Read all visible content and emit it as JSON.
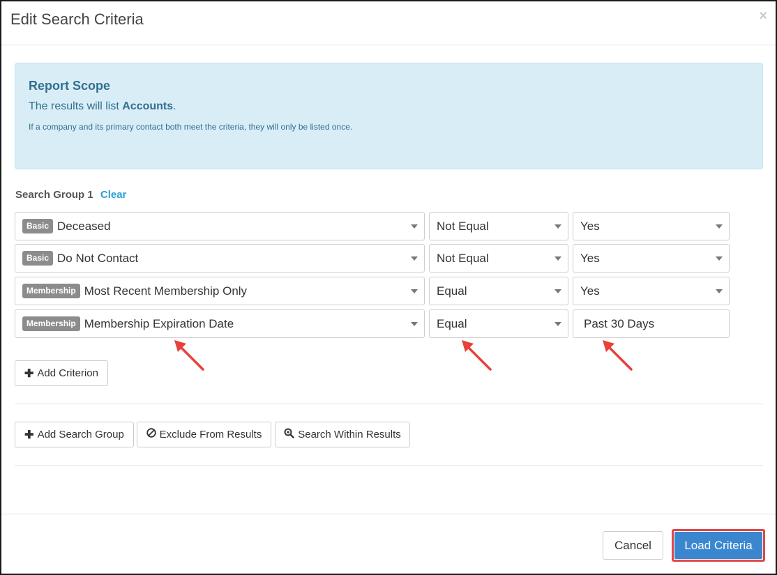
{
  "modal": {
    "title": "Edit Search Criteria",
    "close_symbol": "×"
  },
  "scope": {
    "title": "Report Scope",
    "line_prefix": "The results will list ",
    "line_bold": "Accounts",
    "line_suffix": ".",
    "note": "If a company and its primary contact both meet the criteria, they will only be listed once."
  },
  "group": {
    "title": "Search Group 1",
    "clear_label": "Clear"
  },
  "criteria": [
    {
      "badge": "Basic",
      "field": "Deceased",
      "operator": "Not Equal",
      "value": "Yes",
      "value_type": "select"
    },
    {
      "badge": "Basic",
      "field": "Do Not Contact",
      "operator": "Not Equal",
      "value": "Yes",
      "value_type": "select"
    },
    {
      "badge": "Membership",
      "field": "Most Recent Membership Only",
      "operator": "Equal",
      "value": "Yes",
      "value_type": "select"
    },
    {
      "badge": "Membership",
      "field": "Membership Expiration Date",
      "operator": "Equal",
      "value": "Past 30 Days",
      "value_type": "text"
    }
  ],
  "buttons": {
    "add_criterion": "Add Criterion",
    "add_search_group": "Add Search Group",
    "exclude_from_results": "Exclude From Results",
    "search_within_results": "Search Within Results",
    "cancel": "Cancel",
    "load_criteria": "Load Criteria"
  },
  "colors": {
    "scope_bg": "#d9edf7",
    "scope_text": "#31708f",
    "badge_bg": "#8c8c8c",
    "primary": "#3a87cf",
    "highlight": "#e04848",
    "link": "#2a9fd6"
  },
  "icons": {
    "close": "close-icon",
    "plus": "plus-icon",
    "ban": "ban-icon",
    "zoom": "zoom-in-icon",
    "caret": "chevron-down-icon",
    "annotation_arrow": "arrow-annotation"
  }
}
